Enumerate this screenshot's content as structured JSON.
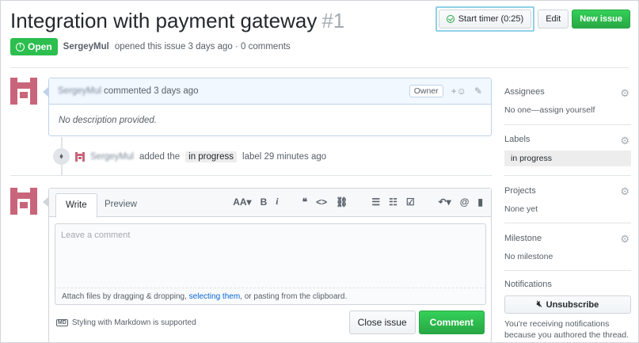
{
  "issue": {
    "title": "Integration with payment gateway",
    "number": "#1",
    "state": "Open",
    "author": "SergeyMul",
    "opened_text": "opened this issue 3 days ago · 0 comments"
  },
  "header_actions": {
    "timer_label": "Start timer (0:25)",
    "edit_label": "Edit",
    "new_issue_label": "New issue"
  },
  "comment": {
    "author": "SergeyMul",
    "action_text": "commented 3 days ago",
    "role_badge": "Owner",
    "body": "No description provided."
  },
  "event": {
    "author": "SergeyMul",
    "text_before": "added the",
    "label": "in progress",
    "text_after": "label 29 minutes ago"
  },
  "editor": {
    "tab_write": "Write",
    "tab_preview": "Preview",
    "placeholder": "Leave a comment",
    "attach_prefix": "Attach files by dragging & dropping,",
    "attach_link": "selecting them",
    "attach_suffix": ", or pasting from the clipboard.",
    "markdown_note": "Styling with Markdown is supported",
    "markdown_icon_text": "MD",
    "close_label": "Close issue",
    "comment_label": "Comment",
    "toolbar": {
      "header": "AA▾",
      "bold": "B",
      "italic": "i",
      "quote": "❝",
      "code": "<>",
      "link": "⛓",
      "ul": "☰",
      "ol": "☷",
      "task": "☑",
      "reply": "↶▾",
      "mention": "@",
      "bookmark": "▮"
    }
  },
  "sidebar": {
    "assignees": {
      "title": "Assignees",
      "value": "No one—assign yourself"
    },
    "labels": {
      "title": "Labels",
      "value": "in progress"
    },
    "projects": {
      "title": "Projects",
      "value": "None yet"
    },
    "milestone": {
      "title": "Milestone",
      "value": "No milestone"
    },
    "notifications": {
      "title": "Notifications",
      "button": "Unsubscribe",
      "text": "You're receiving notifications because you authored the thread."
    }
  },
  "icons": {
    "gear": "gear-icon",
    "timer": "check-circle-icon",
    "tag": "tag-icon",
    "mute": "mute-icon"
  },
  "colors": {
    "open_green": "#2cbe4e",
    "button_green": "#28a745",
    "timer_highlight": "#8fd0e6",
    "comment_head_bg": "#f1f8ff",
    "avatar_pink": "#c9657a",
    "link_blue": "#0366d6"
  }
}
